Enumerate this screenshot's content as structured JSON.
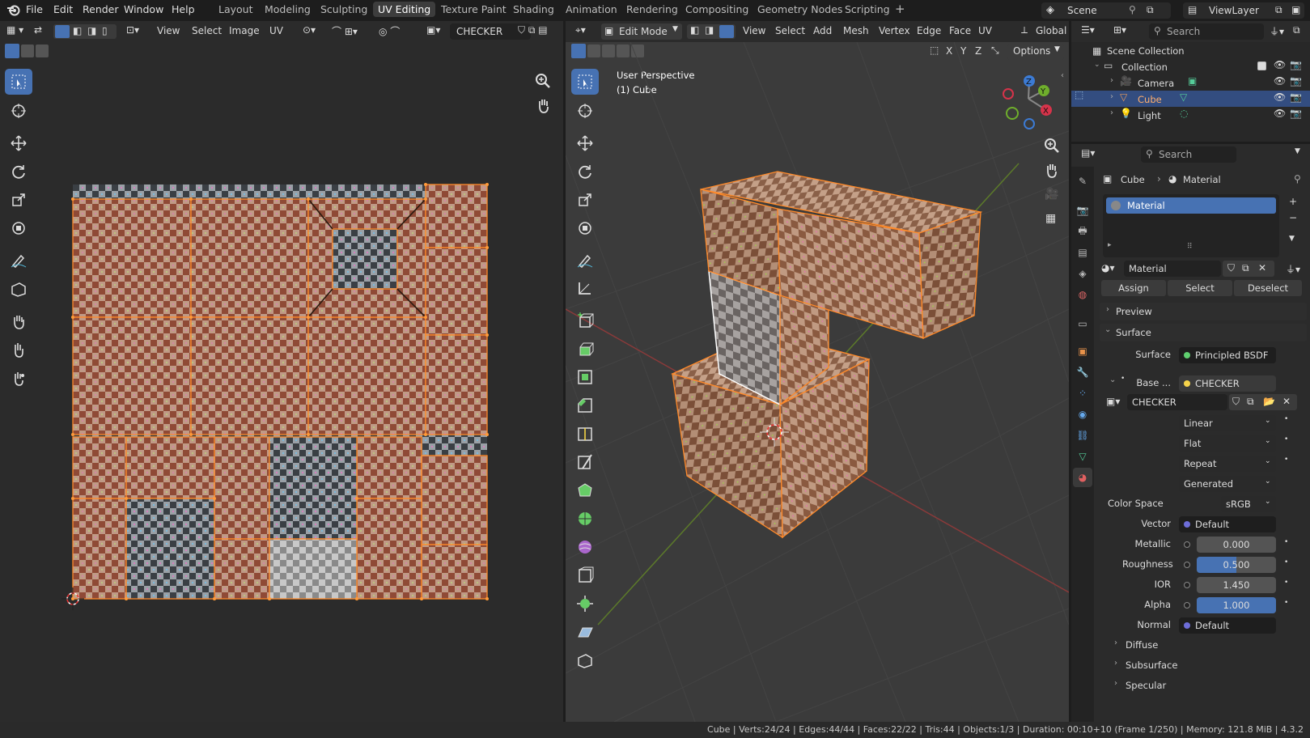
{
  "menu": {
    "file": "File",
    "edit": "Edit",
    "render": "Render",
    "window": "Window",
    "help": "Help"
  },
  "workspaces": [
    "Layout",
    "Modeling",
    "Sculpting",
    "UV Editing",
    "Texture Paint",
    "Shading",
    "Animation",
    "Rendering",
    "Compositing",
    "Geometry Nodes",
    "Scripting"
  ],
  "active_workspace": "UV Editing",
  "scene": {
    "name": "Scene",
    "view_layer": "ViewLayer"
  },
  "uv_editor": {
    "menus": {
      "view": "View",
      "select": "Select",
      "image": "Image",
      "uv": "UV"
    },
    "image_name": "CHECKER"
  },
  "viewport": {
    "mode": "Edit Mode",
    "menus": {
      "view": "View",
      "select": "Select",
      "add": "Add",
      "mesh": "Mesh",
      "vertex": "Vertex",
      "edge": "Edge",
      "face": "Face",
      "uv": "UV"
    },
    "transform": "Global",
    "axes": {
      "x": "X",
      "y": "Y",
      "z": "Z"
    },
    "options": "Options",
    "overlay_line1": "User Perspective",
    "overlay_line2": "(1) Cube"
  },
  "outliner": {
    "search_placeholder": "Search",
    "scene_collection": "Scene Collection",
    "collection": "Collection",
    "items": [
      "Camera",
      "Cube",
      "Light"
    ]
  },
  "properties": {
    "search_placeholder": "Search",
    "breadcrumb_object": "Cube",
    "breadcrumb_material": "Material",
    "slot": "Material",
    "material_name": "Material",
    "assign": "Assign",
    "select": "Select",
    "deselect": "Deselect",
    "preview": "Preview",
    "surface_section": "Surface",
    "surface_label": "Surface",
    "surface_value": "Principled BSDF",
    "base_label": "Base ...",
    "base_value": "CHECKER",
    "image_name": "CHECKER",
    "interp": "Linear",
    "projection": "Flat",
    "extension": "Repeat",
    "source": "Generated",
    "color_space_label": "Color Space",
    "color_space": "sRGB",
    "vector_label": "Vector",
    "vector_value": "Default",
    "metallic_label": "Metallic",
    "metallic": "0.000",
    "roughness_label": "Roughness",
    "roughness": "0.500",
    "roughness_fraction": 0.5,
    "ior_label": "IOR",
    "ior": "1.450",
    "alpha_label": "Alpha",
    "alpha": "1.000",
    "alpha_fraction": 1.0,
    "normal_label": "Normal",
    "normal_value": "Default",
    "diffuse": "Diffuse",
    "subsurface": "Subsurface",
    "specular": "Specular"
  },
  "status": {
    "text": "Cube | Verts:24/24 | Edges:44/44 | Faces:22/22 | Tris:44 | Objects:1/3 | Duration: 00:10+10 (Frame 1/250) | Memory: 121.8 MiB | 4.3.2"
  },
  "colors": {
    "accent": "#4772b3",
    "selection": "#ff8a2a",
    "header": "#2b2b2b"
  }
}
